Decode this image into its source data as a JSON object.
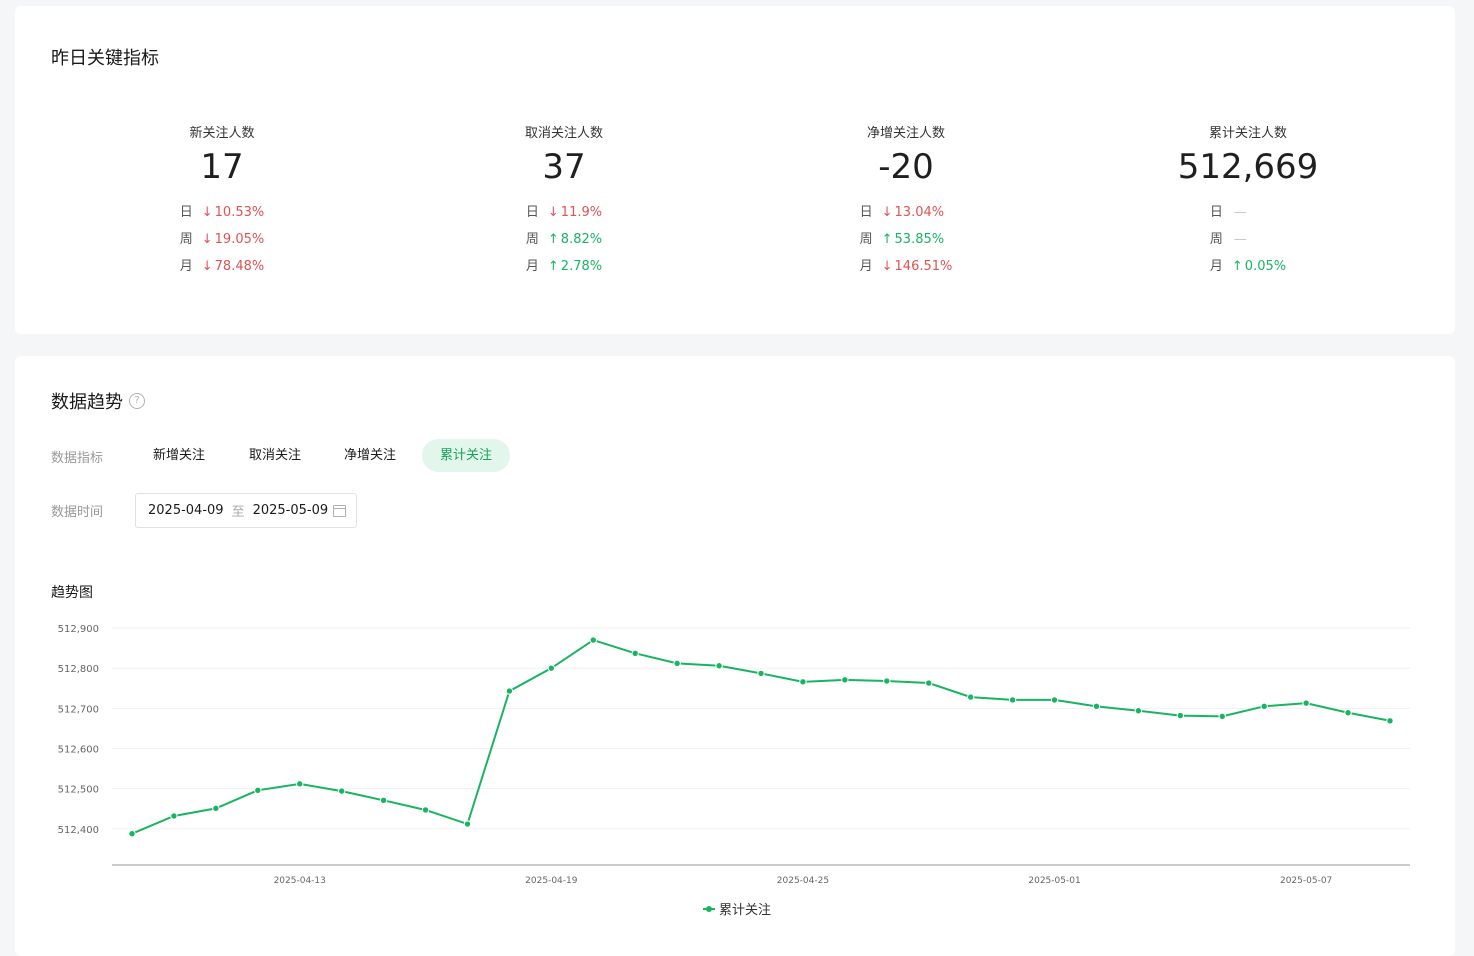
{
  "metrics_section": {
    "title": "昨日关键指标",
    "items": [
      {
        "label": "新关注人数",
        "value": "17",
        "changes": [
          {
            "period": "日",
            "arrow": "↓",
            "value": "10.53%",
            "trend": "down"
          },
          {
            "period": "周",
            "arrow": "↓",
            "value": "19.05%",
            "trend": "down"
          },
          {
            "period": "月",
            "arrow": "↓",
            "value": "78.48%",
            "trend": "down"
          }
        ]
      },
      {
        "label": "取消关注人数",
        "value": "37",
        "changes": [
          {
            "period": "日",
            "arrow": "↓",
            "value": "11.9%",
            "trend": "down"
          },
          {
            "period": "周",
            "arrow": "↑",
            "value": "8.82%",
            "trend": "up"
          },
          {
            "period": "月",
            "arrow": "↑",
            "value": "2.78%",
            "trend": "up"
          }
        ]
      },
      {
        "label": "净增关注人数",
        "value": "-20",
        "changes": [
          {
            "period": "日",
            "arrow": "↓",
            "value": "13.04%",
            "trend": "down"
          },
          {
            "period": "周",
            "arrow": "↑",
            "value": "53.85%",
            "trend": "up"
          },
          {
            "period": "月",
            "arrow": "↓",
            "value": "146.51%",
            "trend": "down"
          }
        ]
      },
      {
        "label": "累计关注人数",
        "value": "512,669",
        "changes": [
          {
            "period": "日",
            "arrow": "",
            "value": "—",
            "trend": "flat"
          },
          {
            "period": "周",
            "arrow": "",
            "value": "—",
            "trend": "flat"
          },
          {
            "period": "月",
            "arrow": "↑",
            "value": "0.05%",
            "trend": "up"
          }
        ]
      }
    ]
  },
  "trend_section": {
    "title": "数据趋势",
    "help_icon": "question-circle-icon",
    "indicator_label": "数据指标",
    "tabs": [
      "新增关注",
      "取消关注",
      "净增关注",
      "累计关注"
    ],
    "active_tab": "累计关注",
    "time_label": "数据时间",
    "date_start": "2025-04-09",
    "date_separator": "至",
    "date_end": "2025-05-09",
    "chart_title": "趋势图"
  },
  "colors": {
    "accent": "#18b462",
    "down": "#e05353",
    "up": "#18b462",
    "active_tab_bg": "#e3f6ec"
  },
  "chart_data": {
    "type": "line",
    "x": [
      "2025-04-09",
      "2025-04-10",
      "2025-04-11",
      "2025-04-12",
      "2025-04-13",
      "2025-04-14",
      "2025-04-15",
      "2025-04-16",
      "2025-04-17",
      "2025-04-18",
      "2025-04-19",
      "2025-04-20",
      "2025-04-21",
      "2025-04-22",
      "2025-04-23",
      "2025-04-24",
      "2025-04-25",
      "2025-04-26",
      "2025-04-27",
      "2025-04-28",
      "2025-04-29",
      "2025-04-30",
      "2025-05-01",
      "2025-05-02",
      "2025-05-03",
      "2025-05-04",
      "2025-05-05",
      "2025-05-06",
      "2025-05-07",
      "2025-05-08",
      "2025-05-09"
    ],
    "x_ticks": [
      "2025-04-13",
      "2025-04-19",
      "2025-04-25",
      "2025-05-01",
      "2025-05-07"
    ],
    "y_ticks": [
      "512,400",
      "512,500",
      "512,600",
      "512,700",
      "512,800",
      "512,900"
    ],
    "ylim": [
      512310,
      512900
    ],
    "series": [
      {
        "name": "累计关注",
        "color": "#18b462",
        "values": [
          512388,
          512432,
          512451,
          512496,
          512512,
          512494,
          512471,
          512447,
          512412,
          512743,
          512800,
          512870,
          512837,
          512812,
          512806,
          512787,
          512766,
          512771,
          512768,
          512763,
          512728,
          512721,
          512721,
          512705,
          512694,
          512682,
          512680,
          512705,
          512713,
          512689,
          512669
        ]
      }
    ],
    "legend_position": "bottom-center",
    "grid": true
  }
}
